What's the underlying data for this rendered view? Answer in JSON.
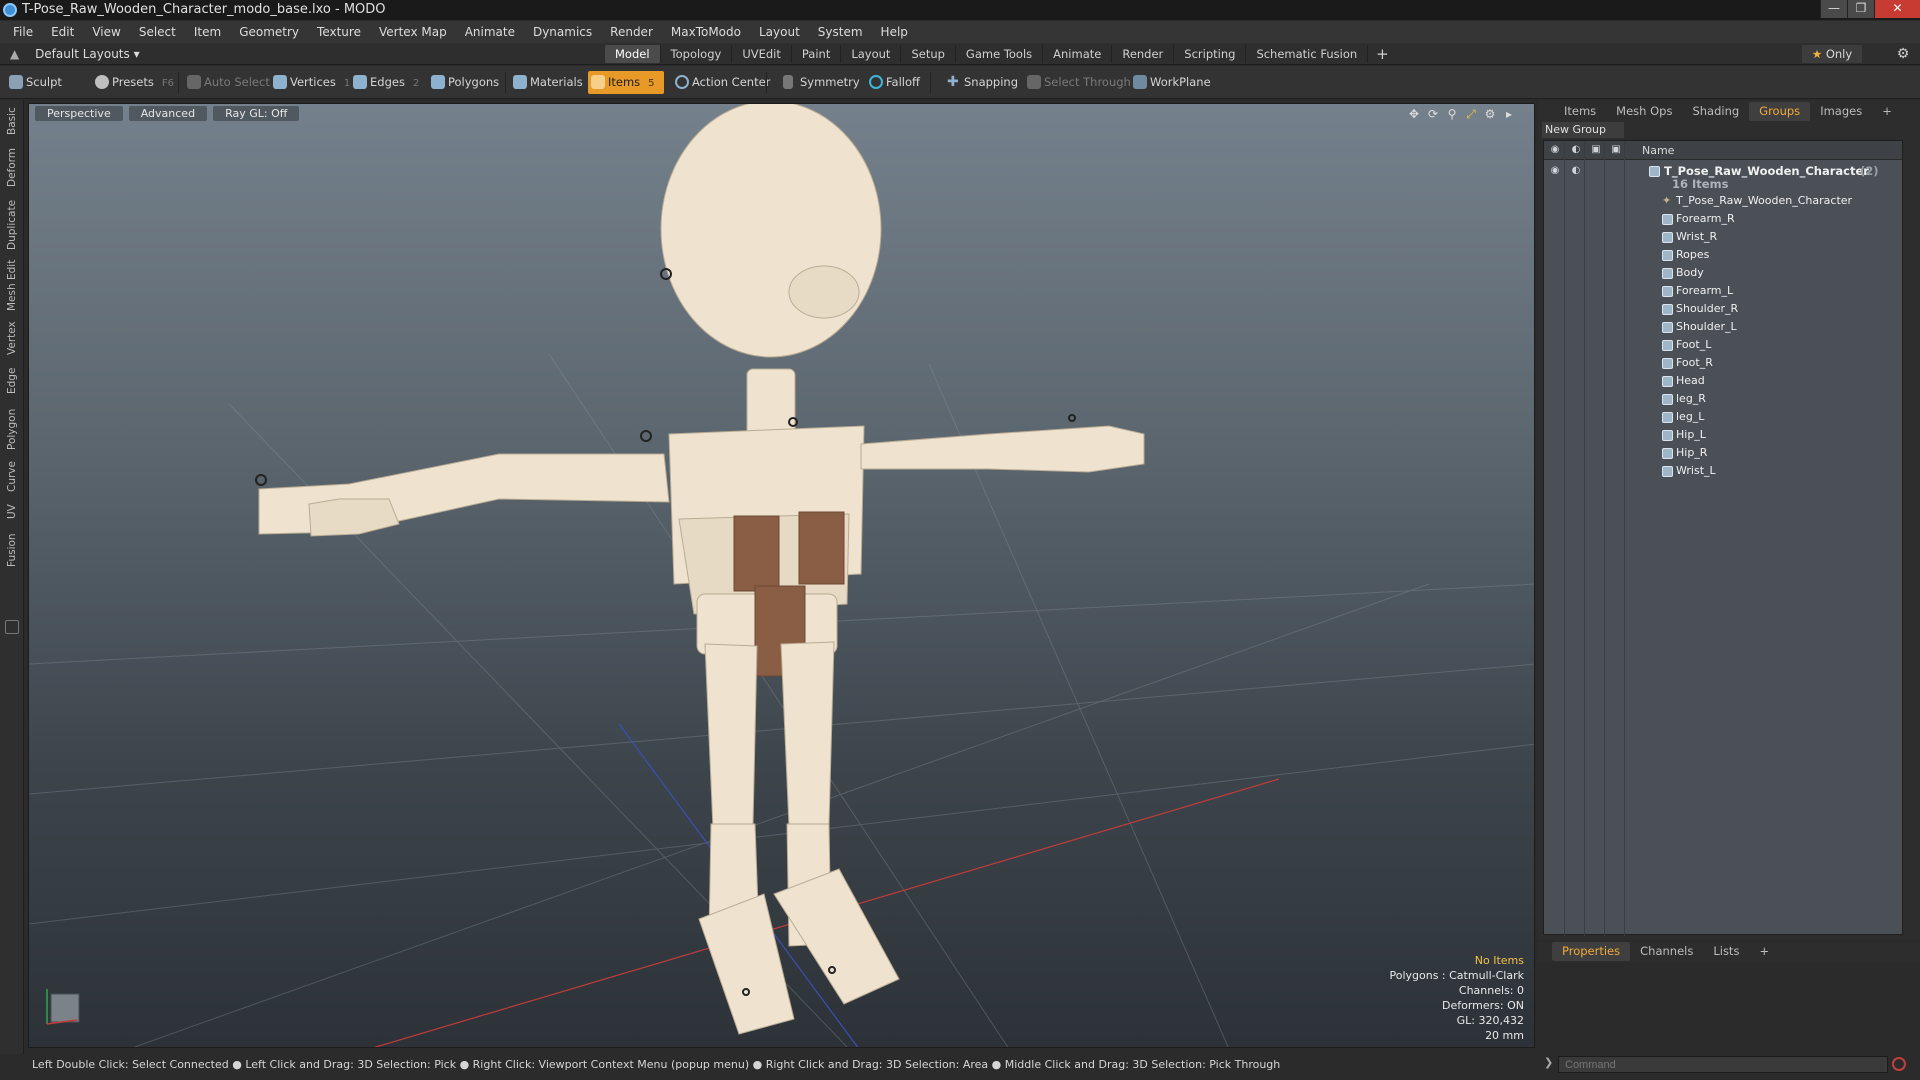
{
  "window": {
    "title": "T-Pose_Raw_Wooden_Character_modo_base.lxo - MODO"
  },
  "menu": [
    "File",
    "Edit",
    "View",
    "Select",
    "Item",
    "Geometry",
    "Texture",
    "Vertex Map",
    "Animate",
    "Dynamics",
    "Render",
    "MaxToModo",
    "Layout",
    "System",
    "Help"
  ],
  "layout_selector": "Default Layouts",
  "workspace_tabs": [
    "Model",
    "Topology",
    "UVEdit",
    "Paint",
    "Layout",
    "Setup",
    "Game Tools",
    "Animate",
    "Render",
    "Scripting",
    "Schematic Fusion"
  ],
  "workspace_active": "Model",
  "only_label": "Only",
  "toolbar": {
    "sculpt": "Sculpt",
    "presets": "Presets",
    "presets_key": "F6",
    "auto_select": "Auto Select",
    "vertices": "Vertices",
    "vertices_key": "1",
    "edges": "Edges",
    "edges_key": "2",
    "polygons": "Polygons",
    "materials": "Materials",
    "items": "Items",
    "items_key": "5",
    "action_center": "Action Center",
    "symmetry": "Symmetry",
    "falloff": "Falloff",
    "snapping": "Snapping",
    "select_through": "Select Through",
    "workplane": "WorkPlane"
  },
  "left_tabs": [
    "Basic",
    "Deform",
    "Duplicate",
    "Mesh Edit",
    "Vertex",
    "Edge",
    "Polygon",
    "Curve",
    "UV",
    "Fusion"
  ],
  "viewport": {
    "view": "Perspective",
    "shading": "Advanced",
    "raygl": "Ray GL: Off",
    "stats": {
      "selection": "No Items",
      "polygons": "Polygons : Catmull-Clark",
      "channels": "Channels: 0",
      "deformers": "Deformers: ON",
      "gl": "GL: 320,432",
      "scale": "20 mm"
    }
  },
  "statusbar": "Left Double Click: Select Connected ● Left Click and Drag: 3D Selection: Pick ● Right Click: Viewport Context Menu (popup menu) ● Right Click and Drag: 3D Selection: Area ● Middle Click and Drag: 3D Selection: Pick Through",
  "right_panel": {
    "tabs": [
      "Items",
      "Mesh Ops",
      "Shading",
      "Groups",
      "Images"
    ],
    "active_tab": "Groups",
    "new_group": "New Group",
    "column_name": "Name",
    "group": {
      "name": "T_Pose_Raw_Wooden_Character",
      "count": "(2)",
      "sub": "16 Items"
    },
    "items": [
      "T_Pose_Raw_Wooden_Character",
      "Forearm_R",
      "Wrist_R",
      "Ropes",
      "Body",
      "Forearm_L",
      "Shoulder_R",
      "Shoulder_L",
      "Foot_L",
      "Foot_R",
      "Head",
      "leg_R",
      "leg_L",
      "Hip_L",
      "Hip_R",
      "Wrist_L"
    ]
  },
  "lower_panel": {
    "tabs": [
      "Properties",
      "Channels",
      "Lists"
    ],
    "active_tab": "Properties"
  },
  "command": {
    "placeholder": "Command"
  },
  "colors": {
    "accent": "#e89a28",
    "tab_active_text": "#f2a93b",
    "close": "#c73b32"
  }
}
